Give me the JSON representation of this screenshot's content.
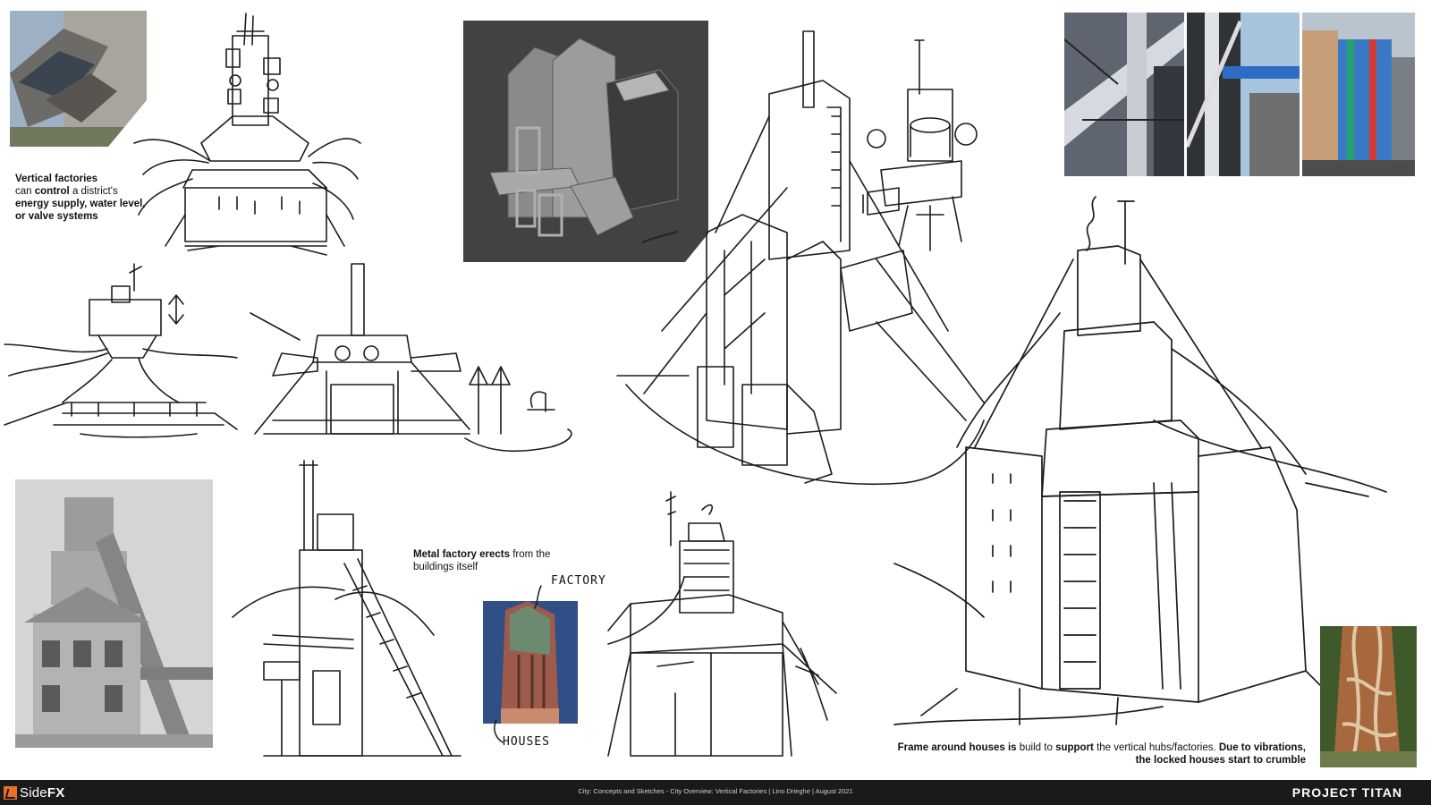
{
  "notes": {
    "vertical_a": "Vertical factories",
    "vertical_b": "can",
    "vertical_c": "control",
    "vertical_d": "a district's",
    "vertical_e": "energy supply, water level,",
    "vertical_f": "or valve systems",
    "metal_a": "Metal factory erects",
    "metal_b": "from the",
    "metal_c": "buildings itself",
    "frame_a": "Frame around houses is",
    "frame_b": "build to",
    "frame_c": "support",
    "frame_d": "the vertical hubs/factories.",
    "frame_e": "Due to vibrations,",
    "frame_f": "the locked houses start to crumble"
  },
  "sketch_labels": {
    "factory": "FACTORY",
    "houses": "HOUSES"
  },
  "footer": {
    "logo_side": "Side",
    "logo_fx": "FX",
    "caption": "City: Concepts and Sketches - City Overview: Vertical Factories | Lino Drieghe | August 2021",
    "brand": "PROJECT TITAN"
  },
  "colors": {
    "footer_bg": "#1a1a1a",
    "logo_accent": "#e8702a",
    "render_bg": "#424242"
  }
}
